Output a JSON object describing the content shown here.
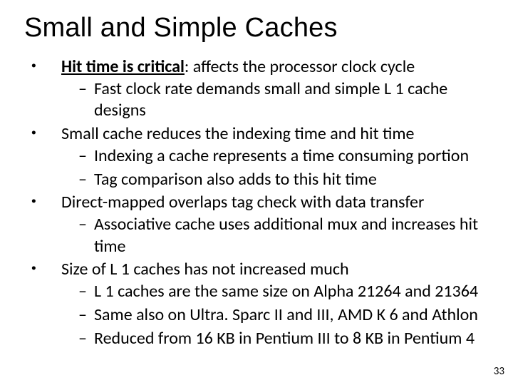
{
  "title": "Small and Simple Caches",
  "bullets": [
    {
      "parts": [
        {
          "text": "Hit time is critical",
          "cls": "hit-critical-strong"
        },
        {
          "text": ": affects the processor clock cycle"
        }
      ],
      "sub": [
        "Fast clock rate demands small and simple L 1 cache designs"
      ]
    },
    {
      "parts": [
        {
          "text": "Small cache reduces the indexing time and hit time"
        }
      ],
      "sub": [
        "Indexing a cache represents a time consuming portion",
        "Tag comparison also adds to this hit time"
      ]
    },
    {
      "parts": [
        {
          "text": "Direct-mapped overlaps tag check with data transfer"
        }
      ],
      "sub": [
        "Associative cache uses additional mux and increases hit time"
      ]
    },
    {
      "parts": [
        {
          "text": "Size of L 1 caches has not increased much"
        }
      ],
      "sub": [
        "L 1 caches are the same size on Alpha 21264 and 21364",
        "Same also on Ultra. Sparc II and III, AMD K 6 and Athlon",
        "Reduced from 16 KB in Pentium III to 8 KB in Pentium 4"
      ]
    }
  ],
  "page_number": "33"
}
